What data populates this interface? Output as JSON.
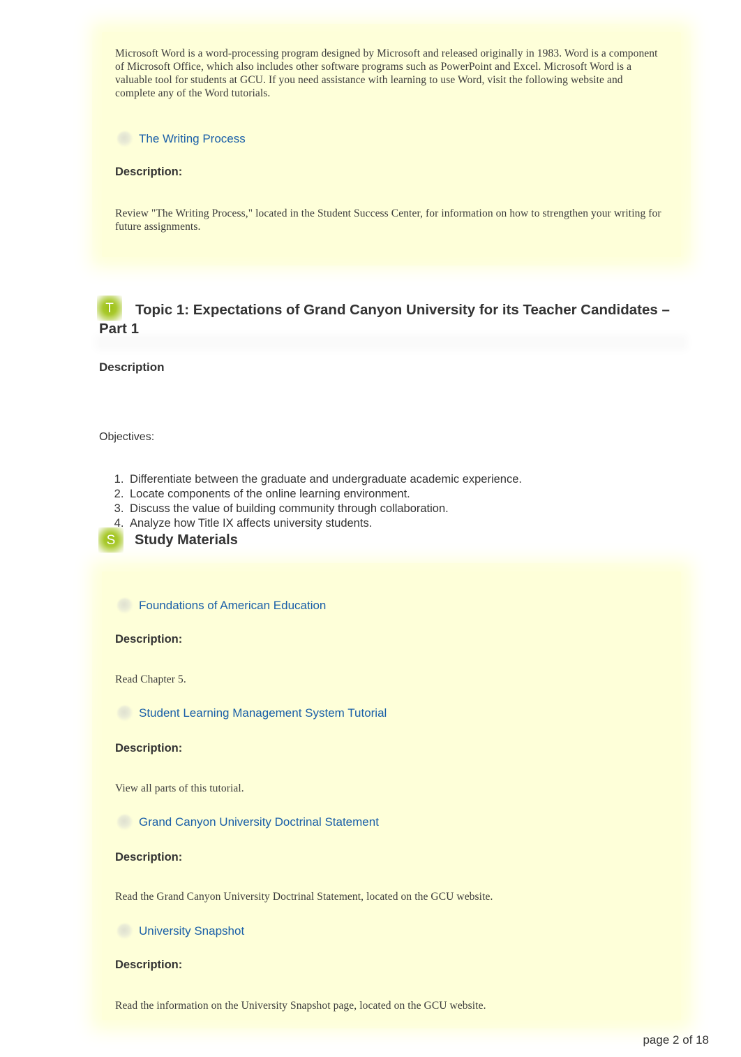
{
  "document": {
    "page_label": "page 2 of 18",
    "link_color": "#1a5fa8",
    "panel_color": "#feffd9",
    "badge_color": "#9ac013"
  },
  "word_block": {
    "paragraph": "Microsoft Word is a word-processing program designed by Microsoft and released originally in 1983. Word is a component of Microsoft Office, which also includes other software programs such as PowerPoint and Excel. Microsoft Word is a valuable tool for students at GCU. If you need assistance with learning to use Word, visit the following website and complete any of the Word tutorials.",
    "resource": {
      "title": "The Writing Process",
      "description_label": "Description:",
      "description": "Review \"The Writing Process,\" located in the Student Success Center, for information on how to strengthen your writing for future assignments."
    }
  },
  "topic": {
    "badge_letter": "T",
    "title": "Topic 1: Expectations of Grand Canyon University for its Teacher Candidates – Part 1",
    "description_heading": "Description",
    "objectives_label": "Objectives:",
    "objectives": [
      "Differentiate between the graduate and undergraduate academic experience.",
      "Locate components of the online learning environment.",
      "Discuss the value of building community through collaboration.",
      "Analyze how Title IX affects university students."
    ]
  },
  "study_materials": {
    "badge_letter": "S",
    "heading": "Study Materials",
    "items": [
      {
        "title": "Foundations of American Education",
        "description_label": "Description:",
        "description": "Read Chapter 5."
      },
      {
        "title": "Student Learning Management System Tutorial",
        "description_label": "Description:",
        "description": "View all parts of this tutorial."
      },
      {
        "title": "Grand Canyon University Doctrinal Statement",
        "description_label": "Description:",
        "description": "Read the Grand Canyon University Doctrinal Statement, located on the GCU website."
      },
      {
        "title": "University Snapshot",
        "description_label": "Description:",
        "description": "Read the information on the University Snapshot page, located on the GCU website."
      }
    ]
  }
}
